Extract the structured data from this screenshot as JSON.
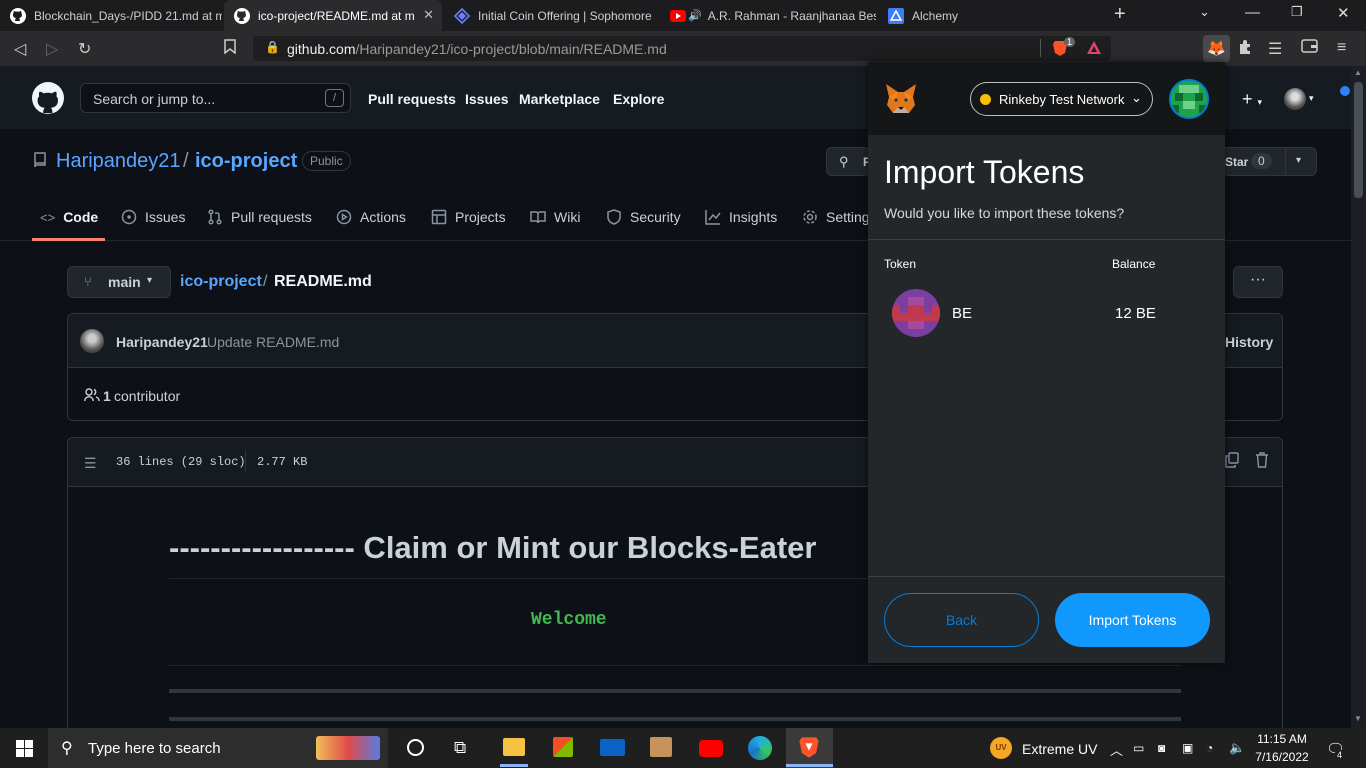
{
  "browser": {
    "tabs": [
      {
        "title": "Blockchain_Days-/PIDD 21.md at m",
        "favicon": "github-icon"
      },
      {
        "title": "ico-project/README.md at m",
        "favicon": "github-icon",
        "active": true
      },
      {
        "title": "Initial Coin Offering | Sophomore",
        "favicon": "diamond-icon"
      },
      {
        "title": "A.R. Rahman - Raanjhanaa Best",
        "favicon": "youtube-icon"
      },
      {
        "title": "Alchemy",
        "favicon": "alchemy-icon"
      }
    ],
    "url_domain": "github.com",
    "url_path": "/Haripandey21/ico-project/blob/main/README.md",
    "brave_badge": "1"
  },
  "github": {
    "search_placeholder": "Search or jump to...",
    "search_key": "/",
    "nav": [
      "Pull requests",
      "Issues",
      "Marketplace",
      "Explore"
    ],
    "owner": "Haripandey21",
    "separator": "/",
    "repo": "ico-project",
    "visibility": "Public",
    "star_label": "Star",
    "star_count": "0",
    "pin_initial": "P",
    "tabs": [
      "Code",
      "Issues",
      "Pull requests",
      "Actions",
      "Projects",
      "Wiki",
      "Security",
      "Insights",
      "Settings"
    ],
    "branch": "main",
    "breadcrumb_repo": "ico-project",
    "breadcrumb_sep": "/",
    "breadcrumb_file": "README.md",
    "commit_author": "Haripandey21",
    "commit_message": "Update README.md",
    "history_label": "History",
    "contributors_count": "1",
    "contributors_label": "contributor",
    "file_lines": "36 lines (29 sloc)",
    "file_size": "2.77 KB",
    "readme_heading": "------------------ Claim or Mint our Blocks-Eater",
    "readme_welcome": "Welcome"
  },
  "metamask": {
    "network": "Rinkeby Test Network",
    "title": "Import Tokens",
    "subtitle": "Would you like to import these tokens?",
    "col_token": "Token",
    "col_balance": "Balance",
    "tokens": [
      {
        "symbol": "BE",
        "balance": "12 BE"
      }
    ],
    "back_label": "Back",
    "import_label": "Import Tokens",
    "accent": "#037dd6",
    "import_bg": "#1098fc"
  },
  "taskbar": {
    "search_placeholder": "Type here to search",
    "weather": "Extreme UV",
    "time": "11:15 AM",
    "date": "7/16/2022",
    "notifications": "4"
  }
}
